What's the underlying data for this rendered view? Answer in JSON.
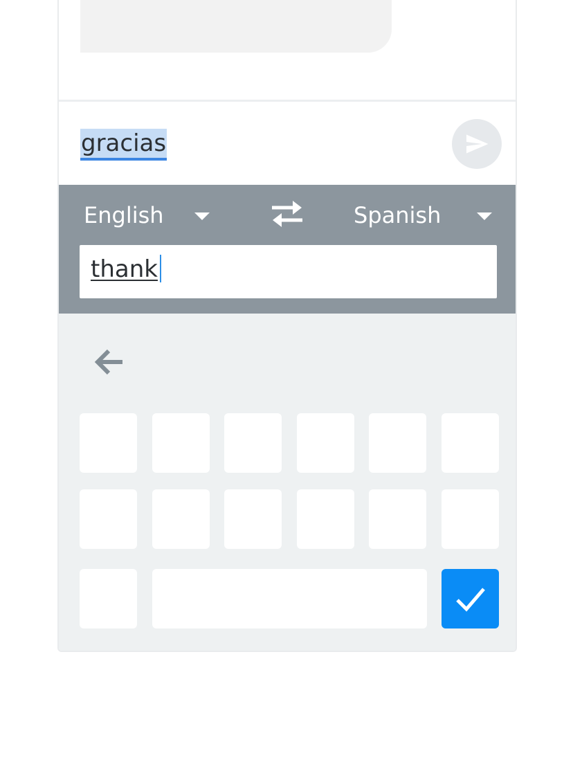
{
  "compose": {
    "text": "gracias"
  },
  "translate": {
    "from_language": "English",
    "to_language": "Spanish",
    "input_value": "thank"
  },
  "icons": {
    "send": "send-icon",
    "swap": "swap-arrows-icon",
    "back": "arrow-back-icon",
    "enter": "check-icon",
    "dropdown": "caret-down-icon"
  },
  "colors": {
    "translate_bar": "#8c969e",
    "selection_highlight": "#c6dcf5",
    "selection_underline": "#3c86e2",
    "enter_key": "#0a8cf6",
    "keyboard_bg": "#eef1f2"
  }
}
